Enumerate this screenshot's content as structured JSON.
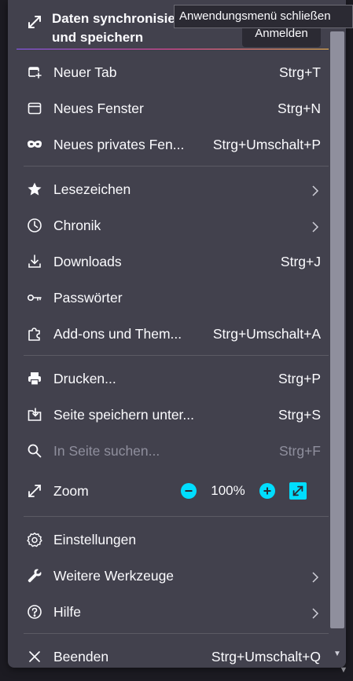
{
  "tooltip": "Anwendungsmenü schließen",
  "sync": {
    "title_line1": "Daten synchronisieren",
    "title_line2": "und speichern",
    "signin_label": "Anmelden"
  },
  "menu": {
    "new_tab": {
      "label": "Neuer Tab",
      "shortcut": "Strg+T"
    },
    "new_window": {
      "label": "Neues Fenster",
      "shortcut": "Strg+N"
    },
    "new_private": {
      "label": "Neues privates Fen...",
      "shortcut": "Strg+Umschalt+P"
    },
    "bookmarks": {
      "label": "Lesezeichen"
    },
    "history": {
      "label": "Chronik"
    },
    "downloads": {
      "label": "Downloads",
      "shortcut": "Strg+J"
    },
    "passwords": {
      "label": "Passwörter"
    },
    "addons": {
      "label": "Add-ons und Them...",
      "shortcut": "Strg+Umschalt+A"
    },
    "print": {
      "label": "Drucken...",
      "shortcut": "Strg+P"
    },
    "save_page": {
      "label": "Seite speichern unter...",
      "shortcut": "Strg+S"
    },
    "find": {
      "label": "In Seite suchen...",
      "shortcut": "Strg+F"
    },
    "zoom": {
      "label": "Zoom",
      "value": "100%"
    },
    "settings": {
      "label": "Einstellungen"
    },
    "more_tools": {
      "label": "Weitere Werkzeuge"
    },
    "help": {
      "label": "Hilfe"
    },
    "quit": {
      "label": "Beenden",
      "shortcut": "Strg+Umschalt+Q"
    }
  },
  "colors": {
    "panel": "#42414d",
    "accent": "#00ddff",
    "text": "#fbfbfe",
    "disabled_text": "#8f8f9d"
  }
}
